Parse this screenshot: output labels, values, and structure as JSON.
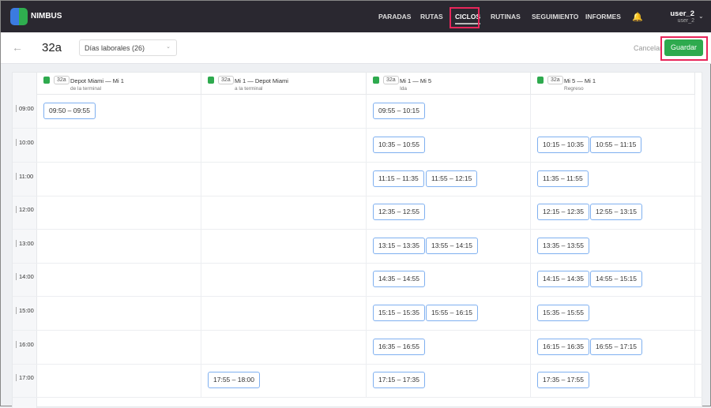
{
  "nav": {
    "brand": "NIMBUS",
    "items": [
      "PARADAS",
      "RUTAS",
      "CICLOS",
      "RUTINAS",
      "SEGUIMIENTO",
      "INFORMES"
    ],
    "active": "CICLOS",
    "user": "user_2",
    "user_sub": "user_2"
  },
  "sub": {
    "title": "32a",
    "select": "Días laborales (26)",
    "cancel": "Cancelar",
    "save": "Guardar"
  },
  "columns": [
    {
      "badge": "32a",
      "name": "Depot Miami — Mi 1",
      "sub": "de la terminal"
    },
    {
      "badge": "32a",
      "name": "Mi 1 — Depot Miami",
      "sub": "a la terminal"
    },
    {
      "badge": "32a",
      "name": "Mi 1 — Mi 5",
      "sub": "Ida"
    },
    {
      "badge": "32a",
      "name": "Mi 5 — Mi 1",
      "sub": "Regreso"
    }
  ],
  "rows": [
    {
      "time": "09:00",
      "cells": [
        [
          "09:50 – 09:55"
        ],
        [],
        [
          "09:55 – 10:15"
        ],
        []
      ]
    },
    {
      "time": "10:00",
      "cells": [
        [],
        [],
        [
          "10:35 – 10:55"
        ],
        [
          "10:15 – 10:35",
          "10:55 – 11:15"
        ]
      ]
    },
    {
      "time": "11:00",
      "cells": [
        [],
        [],
        [
          "11:15 – 11:35",
          "11:55 – 12:15"
        ],
        [
          "11:35 – 11:55"
        ]
      ]
    },
    {
      "time": "12:00",
      "cells": [
        [],
        [],
        [
          "12:35 – 12:55"
        ],
        [
          "12:15 – 12:35",
          "12:55 – 13:15"
        ]
      ]
    },
    {
      "time": "13:00",
      "cells": [
        [],
        [],
        [
          "13:15 – 13:35",
          "13:55 – 14:15"
        ],
        [
          "13:35 – 13:55"
        ]
      ]
    },
    {
      "time": "14:00",
      "cells": [
        [],
        [],
        [
          "14:35 – 14:55"
        ],
        [
          "14:15 – 14:35",
          "14:55 – 15:15"
        ]
      ]
    },
    {
      "time": "15:00",
      "cells": [
        [],
        [],
        [
          "15:15 – 15:35",
          "15:55 – 16:15"
        ],
        [
          "15:35 – 15:55"
        ]
      ]
    },
    {
      "time": "16:00",
      "cells": [
        [],
        [],
        [
          "16:35 – 16:55"
        ],
        [
          "16:15 – 16:35",
          "16:55 – 17:15"
        ]
      ]
    },
    {
      "time": "17:00",
      "cells": [
        [],
        [
          "17:55 – 18:00"
        ],
        [
          "17:15 – 17:35"
        ],
        [
          "17:35 – 17:55"
        ]
      ]
    }
  ]
}
